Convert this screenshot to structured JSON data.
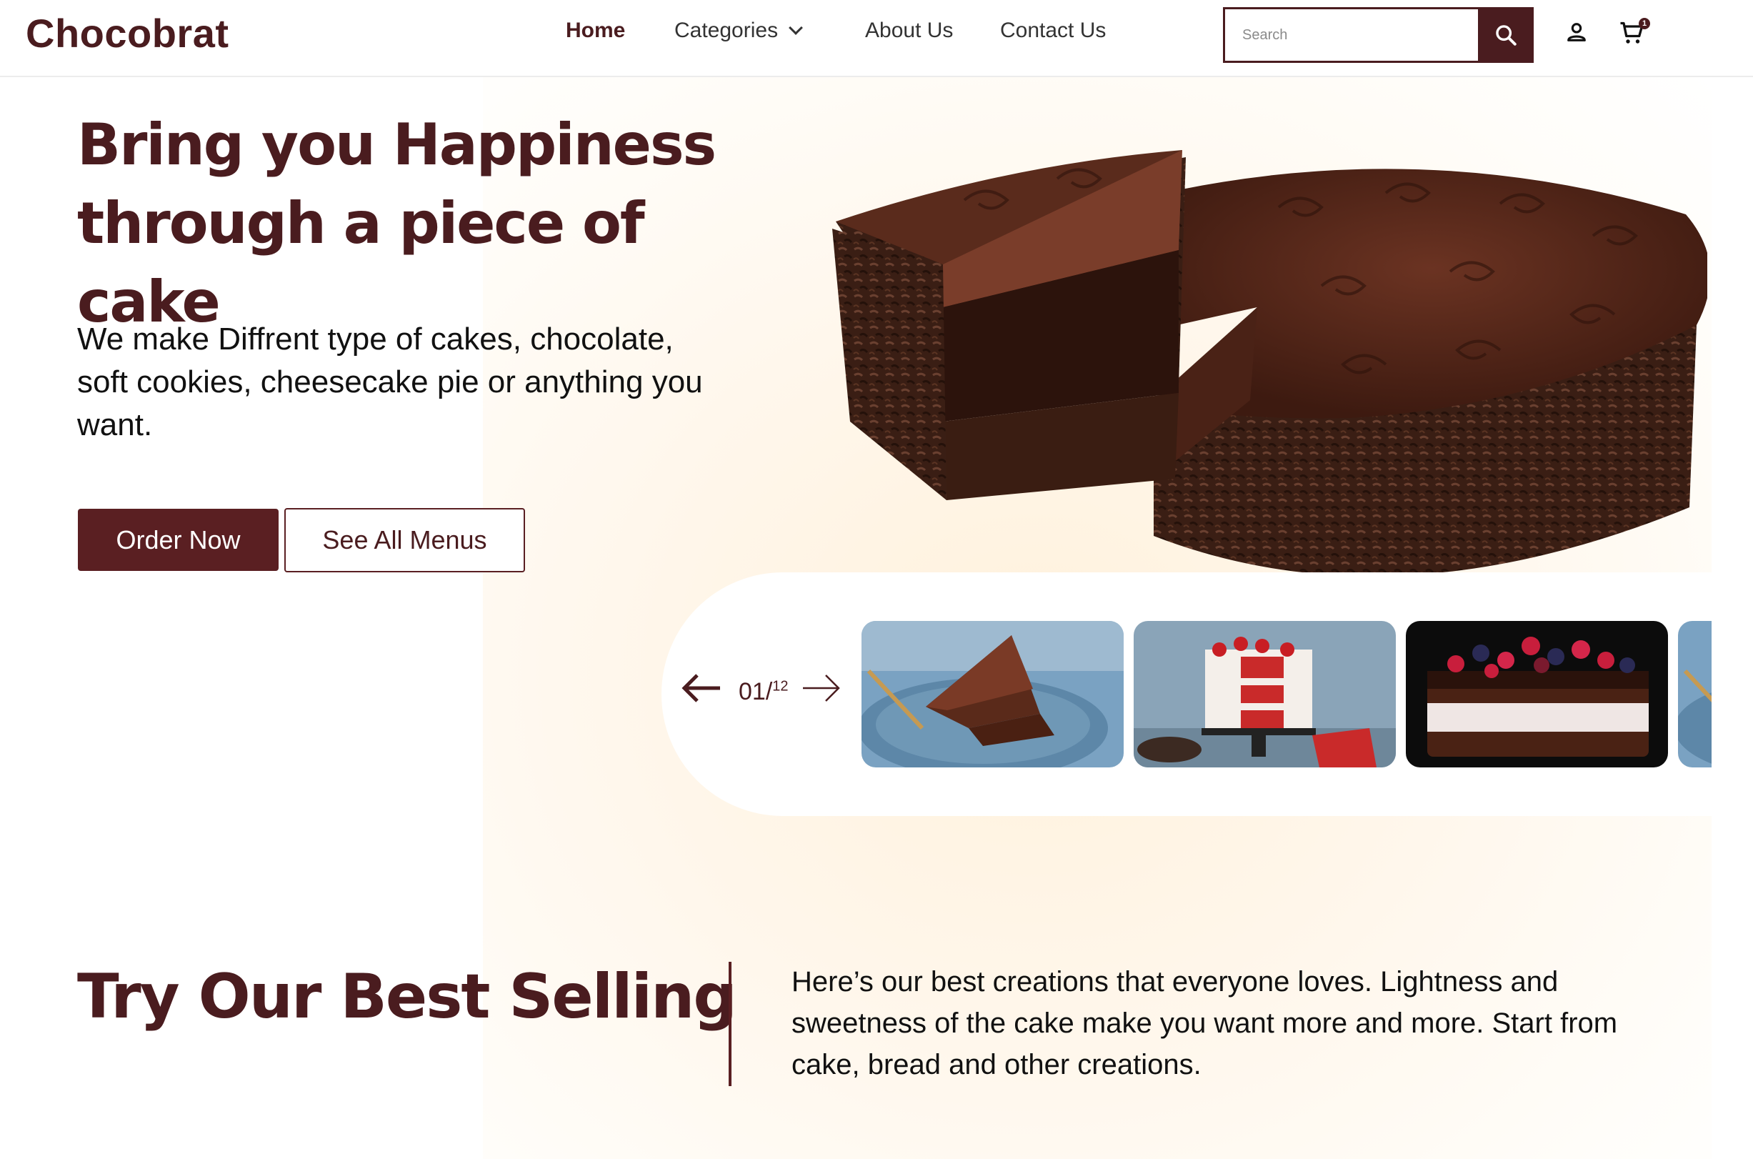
{
  "header": {
    "logo": "Chocobrat",
    "nav": {
      "home": "Home",
      "categories": "Categories",
      "about": "About Us",
      "contact": "Contact Us"
    },
    "search": {
      "placeholder": "Search",
      "value": ""
    },
    "cart_count": "1"
  },
  "hero": {
    "title_line1": "Bring you Happiness",
    "title_line2": "through a piece of cake",
    "description": "We make Diffrent type of cakes, chocolate, soft cookies, cheesecake pie or anything you want.",
    "order_button": "Order Now",
    "menus_button": "See All Menus"
  },
  "carousel": {
    "current": "01/",
    "total": "12",
    "thumbnails": [
      "chocolate-cake-slice",
      "red-velvet-cake",
      "berry-chocolate-cake",
      "chocolate-cake-partial"
    ]
  },
  "best_selling": {
    "title": "Try Our Best Selling",
    "description": "Here’s our best creations that everyone loves. Lightness and sweetness of the cake make you want more and more. Start from cake, bread and other creations."
  },
  "colors": {
    "brand": "#4a1c1f",
    "button": "#5a1f22",
    "hero_glow": "#fff1dc"
  },
  "icons": [
    "chevron-down-icon",
    "search-icon",
    "user-icon",
    "cart-icon",
    "arrow-left-icon",
    "arrow-right-icon"
  ]
}
